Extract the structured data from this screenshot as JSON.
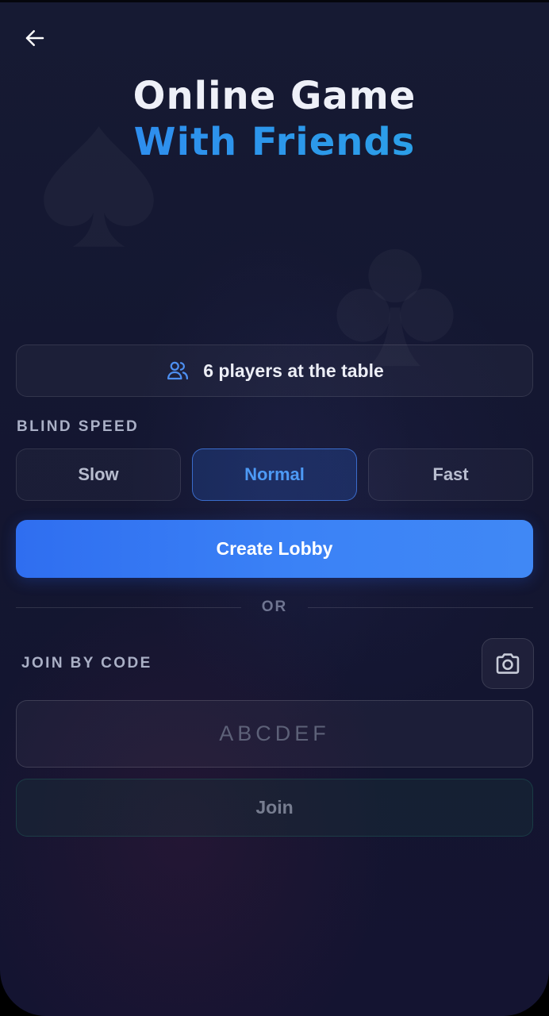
{
  "header": {
    "back_icon": "arrow-left-icon",
    "title_line1": "Online Game",
    "title_line2": "With Friends"
  },
  "players": {
    "icon": "users-icon",
    "text": "6 players at the table"
  },
  "blind_speed": {
    "label": "BLIND SPEED",
    "options": [
      "Slow",
      "Normal",
      "Fast"
    ],
    "selected": "Normal"
  },
  "create_lobby": {
    "label": "Create Lobby"
  },
  "divider": {
    "text": "OR"
  },
  "join": {
    "label": "JOIN BY CODE",
    "camera_icon": "camera-icon",
    "code_placeholder": "ABCDEF",
    "code_value": "",
    "button_label": "Join"
  },
  "colors": {
    "background": "#141731",
    "accent_blue": "#3b82f6",
    "title_gradient_start": "#2f86f0",
    "title_gradient_end": "#2aa7e6",
    "selected_text": "#4d9af5"
  }
}
